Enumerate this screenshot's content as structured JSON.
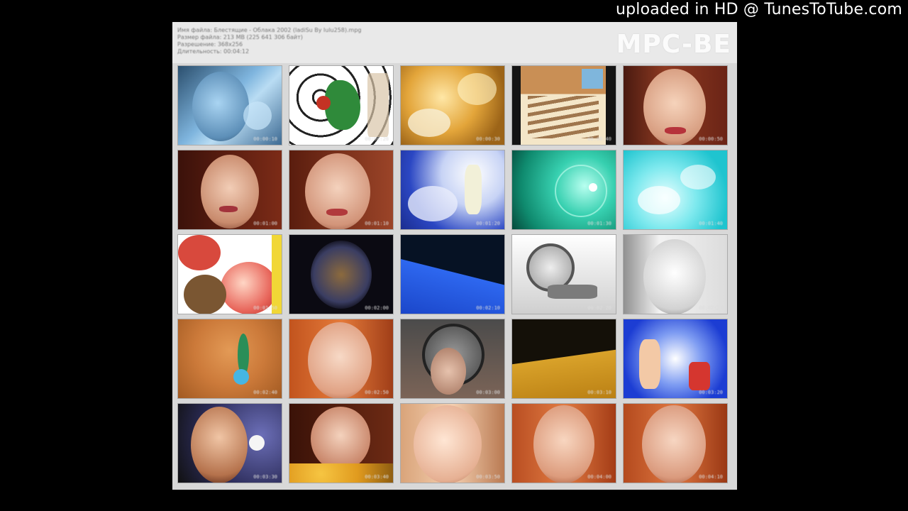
{
  "watermark": "uploaded in HD @ TunesToTube.com",
  "sheet": {
    "info_lines": [
      "Имя файла: Блестящие - Облака 2002 (ladiSu By lulu258).mpg",
      "Размер файла: 213 MB (225 641 306 байт)",
      "Разрешение: 368x256",
      "Длительность: 00:04:12"
    ],
    "logo": "MPC-BE"
  },
  "thumbnails": [
    {
      "time": "00:00:10",
      "scene": "blue-tinted face"
    },
    {
      "time": "00:00:20",
      "scene": "patterned graphic"
    },
    {
      "time": "00:00:30",
      "scene": "golden abstract"
    },
    {
      "time": "00:00:40",
      "scene": "striped interior"
    },
    {
      "time": "00:00:50",
      "scene": "smiling woman"
    },
    {
      "time": "00:01:00",
      "scene": "woman close-up"
    },
    {
      "time": "00:01:10",
      "scene": "woman close-up"
    },
    {
      "time": "00:01:20",
      "scene": "blue clouds"
    },
    {
      "time": "00:01:30",
      "scene": "green swirl"
    },
    {
      "time": "00:01:40",
      "scene": "cyan sky"
    },
    {
      "time": "00:01:50",
      "scene": "lips and balloon"
    },
    {
      "time": "00:02:00",
      "scene": "dark sparkle"
    },
    {
      "time": "00:02:10",
      "scene": "blue plane"
    },
    {
      "time": "00:02:20",
      "scene": "grey clock"
    },
    {
      "time": "00:02:30",
      "scene": "washed-out face"
    },
    {
      "time": "00:02:40",
      "scene": "orange sand"
    },
    {
      "time": "00:02:50",
      "scene": "redhead close-up"
    },
    {
      "time": "00:03:00",
      "scene": "clock portrait"
    },
    {
      "time": "00:03:10",
      "scene": "yellow plane"
    },
    {
      "time": "00:03:20",
      "scene": "blue flowers"
    },
    {
      "time": "00:03:30",
      "scene": "woman with moon"
    },
    {
      "time": "00:03:40",
      "scene": "woman with flowers"
    },
    {
      "time": "00:03:50",
      "scene": "woman hand to face"
    },
    {
      "time": "00:04:00",
      "scene": "redhead portrait"
    },
    {
      "time": "00:04:10",
      "scene": "redhead portrait"
    }
  ]
}
